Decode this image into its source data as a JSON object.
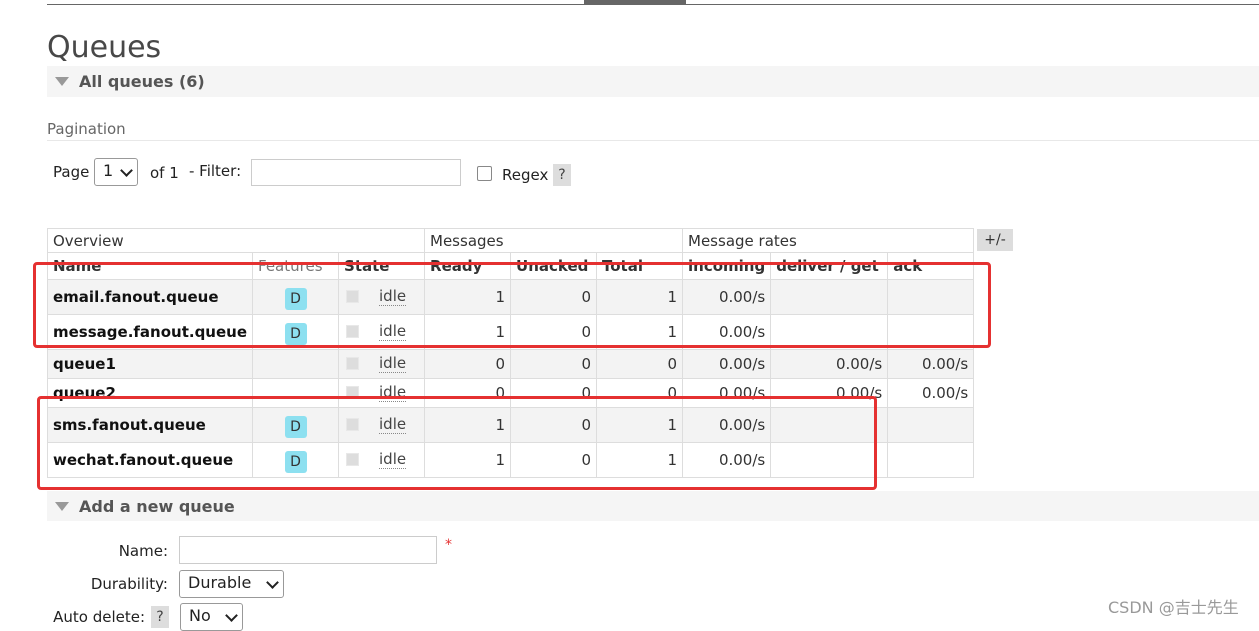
{
  "page": {
    "title": "Queues"
  },
  "all_queues": {
    "label": "All queues (6)"
  },
  "pagination": {
    "label": "Pagination",
    "page_label": "Page",
    "page_value": "1",
    "of_label": "of 1",
    "filter_label": "- Filter:",
    "filter_value": "",
    "regex_label": "Regex",
    "help": "?"
  },
  "table": {
    "group_headers": [
      "Overview",
      "Messages",
      "Message rates"
    ],
    "columns": [
      "Name",
      "Features",
      "State",
      "Ready",
      "Unacked",
      "Total",
      "incoming",
      "deliver / get",
      "ack"
    ],
    "toggle_label": "+/-",
    "rows": [
      {
        "name": "email.fanout.queue",
        "feature": "D",
        "state": "idle",
        "ready": "1",
        "unacked": "0",
        "total": "1",
        "incoming": "0.00/s",
        "deliver_get": "",
        "ack": ""
      },
      {
        "name": "message.fanout.queue",
        "feature": "D",
        "state": "idle",
        "ready": "1",
        "unacked": "0",
        "total": "1",
        "incoming": "0.00/s",
        "deliver_get": "",
        "ack": ""
      },
      {
        "name": "queue1",
        "feature": "",
        "state": "idle",
        "ready": "0",
        "unacked": "0",
        "total": "0",
        "incoming": "0.00/s",
        "deliver_get": "0.00/s",
        "ack": "0.00/s"
      },
      {
        "name": "queue2",
        "feature": "",
        "state": "idle",
        "ready": "0",
        "unacked": "0",
        "total": "0",
        "incoming": "0.00/s",
        "deliver_get": "0.00/s",
        "ack": "0.00/s"
      },
      {
        "name": "sms.fanout.queue",
        "feature": "D",
        "state": "idle",
        "ready": "1",
        "unacked": "0",
        "total": "1",
        "incoming": "0.00/s",
        "deliver_get": "",
        "ack": ""
      },
      {
        "name": "wechat.fanout.queue",
        "feature": "D",
        "state": "idle",
        "ready": "1",
        "unacked": "0",
        "total": "1",
        "incoming": "0.00/s",
        "deliver_get": "",
        "ack": ""
      }
    ]
  },
  "add_queue": {
    "label": "Add a new queue",
    "name_label": "Name:",
    "name_value": "",
    "required_mark": "*",
    "durability_label": "Durability:",
    "durability_value": "Durable",
    "auto_delete_label": "Auto delete:",
    "auto_delete_help": "?",
    "auto_delete_value": "No"
  },
  "watermark": "CSDN @吉士先生",
  "colors": {
    "highlight": "#e53131",
    "feature_badge": "#8de0f0"
  }
}
